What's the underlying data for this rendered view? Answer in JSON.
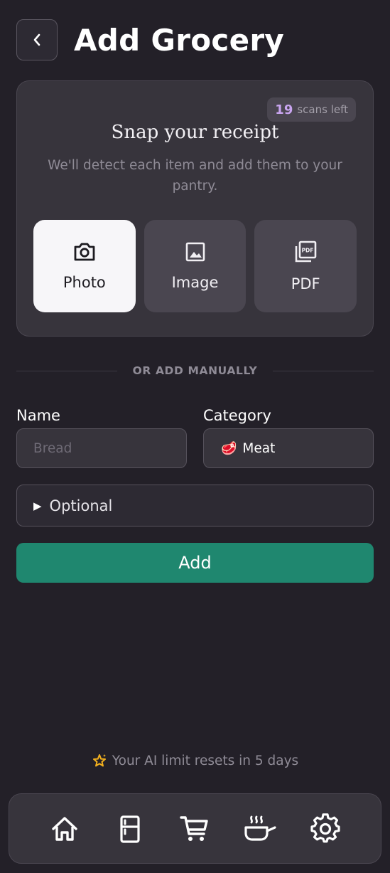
{
  "header": {
    "title": "Add Grocery"
  },
  "scan": {
    "scans_left_count": "19",
    "scans_left_label": "scans left",
    "title": "Snap your receipt",
    "subtitle": "We'll detect each item and add them to your pantry.",
    "options": [
      {
        "label": "Photo",
        "icon": "camera-icon",
        "active": true
      },
      {
        "label": "Image",
        "icon": "image-icon",
        "active": false
      },
      {
        "label": "PDF",
        "icon": "pdf-icon",
        "active": false
      }
    ]
  },
  "divider_label": "OR ADD MANUALLY",
  "form": {
    "name_label": "Name",
    "name_placeholder": "Bread",
    "name_value": "",
    "category_label": "Category",
    "category_emoji": "🥩",
    "category_value": "Meat",
    "optional_label": "Optional",
    "add_label": "Add"
  },
  "footer": {
    "ai_limit_text": "Your AI limit resets in 5 days"
  },
  "nav": {
    "items": [
      "home-icon",
      "fridge-icon",
      "cart-icon",
      "cooking-pot-icon",
      "gear-icon"
    ]
  },
  "colors": {
    "background": "#232028",
    "card": "#37343c",
    "accent_green": "#1f876f",
    "scans_count": "#c9a5f0",
    "sparkle": "#f2b01e"
  }
}
